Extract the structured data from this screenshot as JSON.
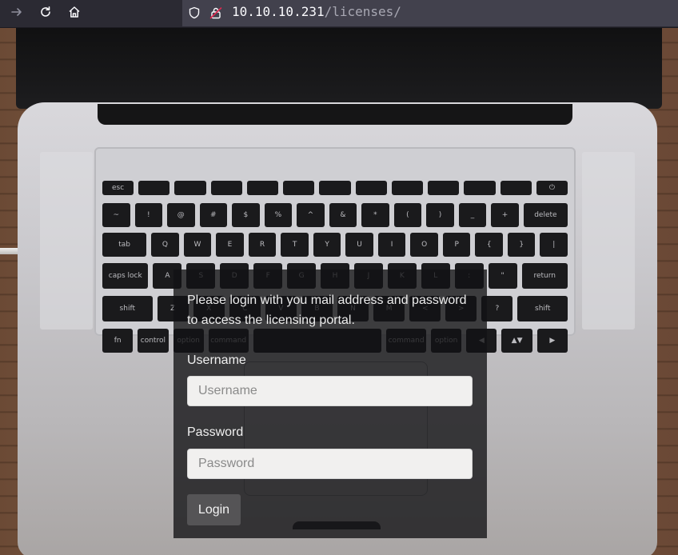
{
  "browser": {
    "nav": {
      "forward_icon": "arrow-right-icon",
      "reload_icon": "reload-icon",
      "home_icon": "home-icon"
    },
    "address_bar": {
      "host": "10.10.10.231",
      "path": "/licenses/",
      "security_icons": [
        "shield-icon",
        "lock-icon"
      ]
    }
  },
  "login": {
    "intro": "Please login with you mail address and password to access the licensing portal.",
    "username_label": "Username",
    "username_placeholder": "Username",
    "username_value": "",
    "password_label": "Password",
    "password_placeholder": "Password",
    "password_value": "",
    "submit_label": "Login"
  },
  "keyboard": {
    "rows": [
      [
        "esc",
        "",
        "",
        "",
        "",
        "",
        "",
        "",
        "",
        "",
        "",
        "",
        "⏻"
      ],
      [
        "~",
        "!",
        "@",
        "#",
        "$",
        "%",
        "^",
        "&",
        "*",
        "(",
        ")",
        "_",
        "+",
        "delete"
      ],
      [
        "tab",
        "Q",
        "W",
        "E",
        "R",
        "T",
        "Y",
        "U",
        "I",
        "O",
        "P",
        "{",
        "}",
        "|"
      ],
      [
        "caps lock",
        "A",
        "S",
        "D",
        "F",
        "G",
        "H",
        "J",
        "K",
        "L",
        ":",
        "\"",
        "return"
      ],
      [
        "shift",
        "Z",
        "X",
        "C",
        "V",
        "B",
        "N",
        "M",
        "<",
        ">",
        "?",
        "shift"
      ],
      [
        "fn",
        "control",
        "option",
        "command",
        "",
        "command",
        "option",
        "◀",
        "▲▼",
        "▶"
      ]
    ]
  },
  "colors": {
    "toolbar_bg": "#2b2a33",
    "urlbar_bg": "#42414d",
    "panel_bg": "rgba(18,18,20,0.78)",
    "button_bg": "#555456"
  }
}
